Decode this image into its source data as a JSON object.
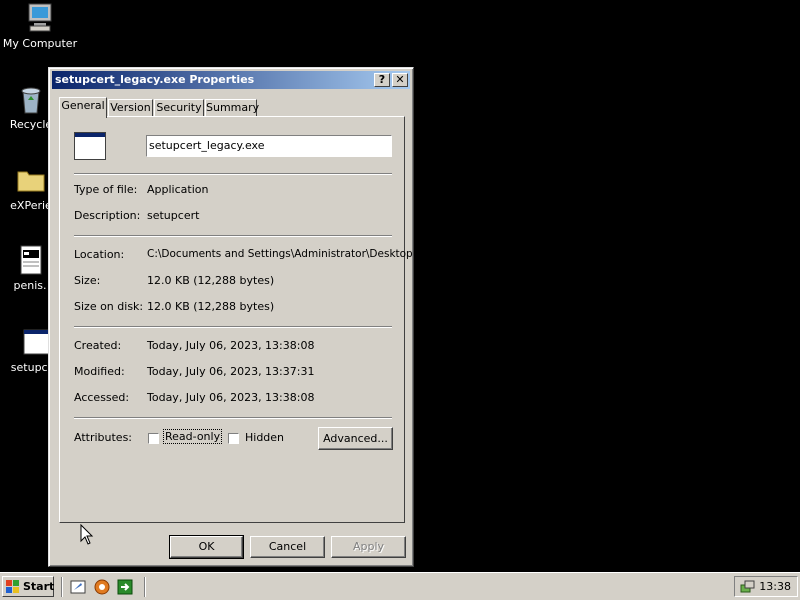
{
  "desktop": {
    "icons": [
      {
        "label": "My Computer",
        "icon": "my-computer-icon"
      },
      {
        "label": "Recycle",
        "icon": "recycle-bin-icon"
      },
      {
        "label": "eXPerie",
        "icon": "folder-icon"
      },
      {
        "label": "penis.",
        "icon": "file-icon"
      },
      {
        "label": "setupcert",
        "icon": "exe-window-icon"
      }
    ]
  },
  "dialog": {
    "title": "setupcert_legacy.exe Properties",
    "help_button": "?",
    "close_button": "✕",
    "tabs": [
      "General",
      "Version",
      "Security",
      "Summary"
    ],
    "active_tab": "General",
    "filename": "setupcert_legacy.exe",
    "fields": {
      "type_label": "Type of file:",
      "type_value": "Application",
      "desc_label": "Description:",
      "desc_value": "setupcert",
      "location_label": "Location:",
      "location_value": "C:\\Documents and Settings\\Administrator\\Desktop",
      "size_label": "Size:",
      "size_value": "12.0 KB (12,288 bytes)",
      "size_disk_label": "Size on disk:",
      "size_disk_value": "12.0 KB (12,288 bytes)",
      "created_label": "Created:",
      "created_value": "Today, July 06, 2023, 13:38:08",
      "modified_label": "Modified:",
      "modified_value": "Today, July 06, 2023, 13:37:31",
      "accessed_label": "Accessed:",
      "accessed_value": "Today, July 06, 2023, 13:38:08"
    },
    "attributes": {
      "label": "Attributes:",
      "readonly_label": "Read-only",
      "readonly_checked": false,
      "hidden_label": "Hidden",
      "hidden_checked": false,
      "advanced_button": "Advanced..."
    },
    "buttons": {
      "ok": "OK",
      "cancel": "Cancel",
      "apply": "Apply"
    }
  },
  "taskbar": {
    "start_label": "Start",
    "clock": "13:38",
    "quick_launch": [
      "show-desktop-icon",
      "browser-icon",
      "switch-windows-icon"
    ]
  }
}
